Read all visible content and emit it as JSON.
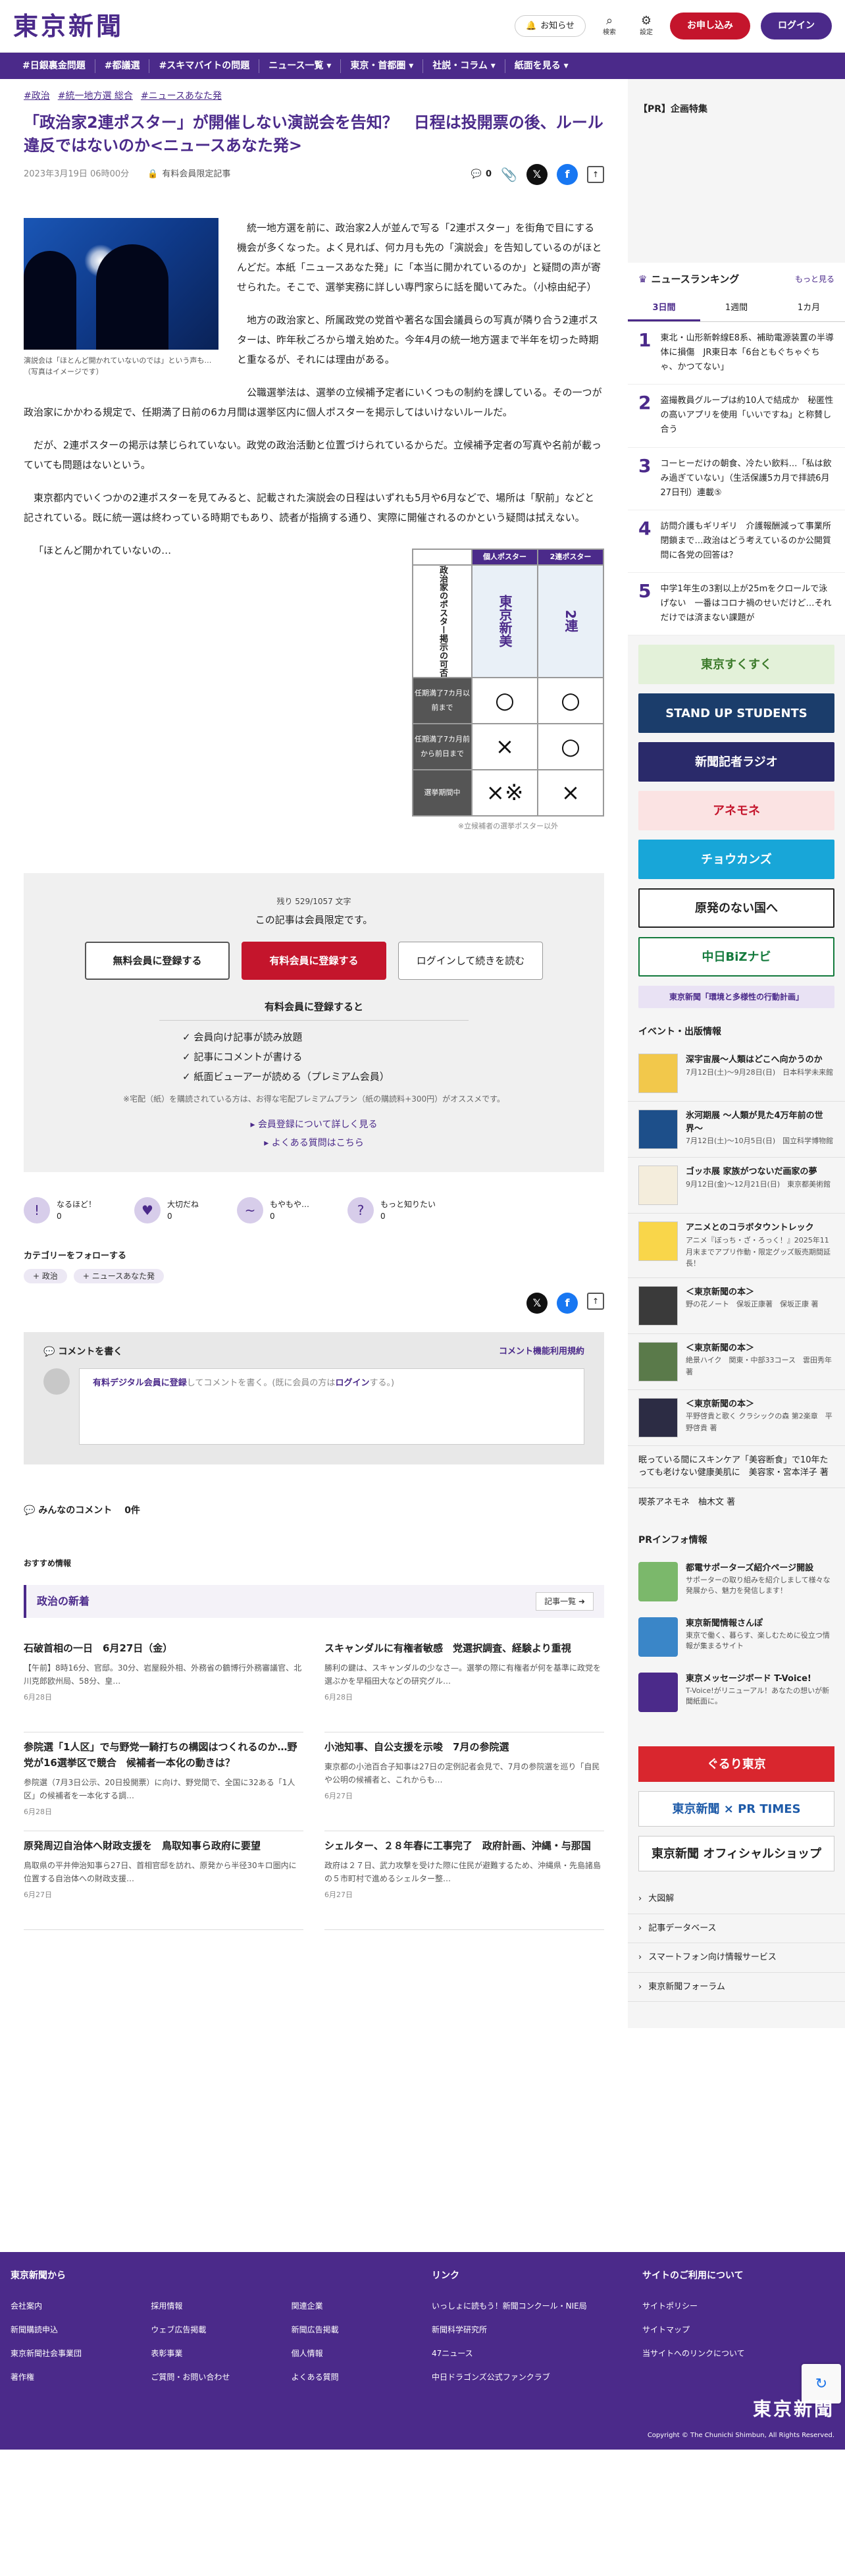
{
  "header": {
    "logo": "東京新聞",
    "notice_label": "お知らせ",
    "search_label": "検索",
    "settings_label": "設定",
    "apply_label": "お申し込み",
    "login_label": "ログイン"
  },
  "nav": [
    "#日銀裏金問題",
    "#都議選",
    "#スキマバイトの問題",
    "ニュース一覧 ▾",
    "東京・首都圏 ▾",
    "社説・コラム ▾",
    "紙面を見る ▾"
  ],
  "article": {
    "tags": [
      "#政治",
      "#統一地方選 総合",
      "#ニュースあなた発"
    ],
    "title": "「政治家2連ポスター」が開催しない演説会を告知？　日程は投開票の後、ルール違反ではないのか<ニュースあなた発>",
    "date": "2023年3月19日 06時00分",
    "members_only": "有料会員限定記事",
    "comment_count": "0",
    "photo_caption": "演説会は「ほとんど開かれていないのでは」という声も…（写真はイメージです）",
    "paragraphs": [
      "統一地方選を前に、政治家2人が並んで写る「2連ポスター」を街角で目にする機会が多くなった。よく見れば、何カ月も先の「演説会」を告知しているのがほとんどだ。本紙「ニュースあなた発」に「本当に開かれているのか」と疑問の声が寄せられた。そこで、選挙実務に詳しい専門家らに話を聞いてみた。（小椋由紀子）",
      "地方の政治家と、所属政党の党首や著名な国会議員らの写真が隣り合う2連ポスターは、昨年秋ごろから増え始めた。今年4月の統一地方選まで半年を切った時期と重なるが、それには理由がある。",
      "公職選挙法は、選挙の立候補予定者にいくつもの制約を課している。その一つが政治家にかかわる規定で、任期満了日前の6カ月間は選挙区内に個人ポスターを掲示してはいけないルールだ。",
      "だが、2連ポスターの掲示は禁じられていない。政党の政治活動と位置づけられているからだ。立候補予定者の写真や名前が載っていても問題はないという。",
      "東京都内でいくつかの2連ポスターを見てみると、記載された演説会の日程はいずれも5月や6月などで、場所は「駅前」などと記されている。既に統一選は終わっている時期でもあり、読者が指摘する通り、実際に開催されるのかという疑問は拭えない。",
      "「ほとんど開かれていないの…"
    ],
    "chart": {
      "col_headers": [
        "個人ポスター",
        "2連ポスター"
      ],
      "row_poster_label": "政治家のポスター掲示の可否",
      "rows": [
        {
          "label": "任期満了7カ月以前まで",
          "a": "○",
          "b": "○"
        },
        {
          "label": "任期満了7カ月前から前日まで",
          "a": "×",
          "b": "○"
        },
        {
          "label": "選挙期間中",
          "a": "×※",
          "b": "×"
        }
      ],
      "poster_text_a": "東京新美",
      "poster_text_b": "2連",
      "note": "※立候補者の選挙ポスター以外"
    }
  },
  "member": {
    "remain": "残り 529/1057 文字",
    "lead": "この記事は会員限定です。",
    "free_btn": "無料会員に登録する",
    "paid_btn": "有料会員に登録する",
    "login_btn": "ログインして続きを読む",
    "benefits_title": "有料会員に登録すると",
    "benefits": [
      "会員向け記事が読み放題",
      "記事にコメントが書ける",
      "紙面ビューアーが読める（プレミアム会員）"
    ],
    "note": "※宅配（紙）を購読されている方は、お得な宅配プレミアムプラン（紙の購読料+300円）がオススメです。",
    "link1": "会員登録について詳しく見る",
    "link2": "よくある質問はこちら"
  },
  "reactions": [
    {
      "icon": "!",
      "label": "なるほど！",
      "count": "0"
    },
    {
      "icon": "♥",
      "label": "大切だね",
      "count": "0"
    },
    {
      "icon": "~",
      "label": "もやもや…",
      "count": "0"
    },
    {
      "icon": "?",
      "label": "もっと知りたい",
      "count": "0"
    }
  ],
  "follow": {
    "title": "カテゴリーをフォローする",
    "tags": [
      "+ 政治",
      "+ ニュースあなた発"
    ]
  },
  "comment": {
    "title": "コメントを書く",
    "rules": "コメント機能利用規約",
    "prompt_link": "有料デジタル会員に登録",
    "prompt_mid": "してコメントを書く。(既に会員の方は",
    "prompt_login": "ログイン",
    "prompt_end": "する。)",
    "all_label": "みんなのコメント",
    "all_count": "0件"
  },
  "recommend_label": "おすすめ情報",
  "latest": {
    "title": "政治の新着",
    "more": "記事一覧 ➜",
    "items": [
      {
        "t": "石破首相の一日　6月27日（金）",
        "d": "【午前】8時16分、官邸。30分、岩屋殺外相、外務省の鶴博行外務審議官、北川克郎欧州局、58分、皇…",
        "dt": "6月28日"
      },
      {
        "t": "スキャンダルに有権者敏感　党選択調査、経験より重視",
        "d": "勝利の鍵は、スキャンダルの少なさ—。選挙の際に有権者が何を基準に政党を選ぶかを早稲田大などの研究グル…",
        "dt": "6月28日"
      },
      {
        "t": "参院選「1人区」で与野党一騎打ちの構図はつくれるのか…野党が16選挙区で競合　候補者一本化の動きは？",
        "d": "参院選（7月3日公示、20日投開票）に向け、野党間で、全国に32ある「1人区」の候補者を一本化する調…",
        "dt": "6月28日"
      },
      {
        "t": "小池知事、自公支援を示唆　7月の参院選",
        "d": "東京都の小池百合子知事は27日の定例記者会見で、7月の参院選を巡り「自民や公明の候補者と、これからも…",
        "dt": "6月27日"
      },
      {
        "t": "原発周辺自治体へ財政支援を　鳥取知事ら政府に要望",
        "d": "鳥取県の平井伸治知事ら27日、首相官邸を訪れ、原発から半径30キロ圏内に位置する自治体への財政支援…",
        "dt": "6月27日"
      },
      {
        "t": "シェルター、２８年春に工事完了　政府計画、沖縄・与那国",
        "d": "政府は２７日、武力攻撃を受けた際に住民が避難するため、沖縄県・先島諸島の５市町村で進めるシェルター整…",
        "dt": "6月27日"
      }
    ]
  },
  "sidebar": {
    "pr_title": "【PR】企画特集",
    "ranking_title": "ニュースランキング",
    "ranking_more": "もっと見る",
    "tabs": [
      "3日間",
      "1週間",
      "1カ月"
    ],
    "ranking": [
      "東北・山形新幹線E8系、補助電源装置の半導体に損傷　JR東日本「6台ともぐちゃぐちゃ、かつてない」",
      "盗撮教員グループは約10人で結成か　秘匿性の高いアプリを使用「いいですね」と称賛し合う",
      "コーヒーだけの朝食、冷たい飲料…「私は飲み過ぎていない」（生活保護5カ月で拝読6月27日刊）連載⑤",
      "訪問介護もギリギリ　介護報酬減って事業所閉鎖まで…政治はどう考えているのか公開質問に各党の回答は？",
      "中学1年生の3割以上が25mをクロールで泳げない　一番はコロナ禍のせいだけど…それだけでは済まない課題が"
    ],
    "banners": [
      "東京すくすく",
      "STAND UP STUDENTS",
      "新聞記者ラジオ",
      "アネモネ",
      "チョウカンズ",
      "原発のない国へ",
      "中日BiZナビ",
      "東京新聞「環境と多様性の行動計画」"
    ],
    "events_title": "イベント・出版情報",
    "events": [
      {
        "t": "深宇宙展〜人類はどこへ向かうのか",
        "d": "7月12日(土)〜9月28日(日)　日本科学未来館"
      },
      {
        "t": "氷河期展 〜人類が見た4万年前の世界〜",
        "d": "7月12日(土)〜10月5日(日)　国立科学博物館"
      },
      {
        "t": "ゴッホ展 家族がつないだ画家の夢",
        "d": "9月12日(金)〜12月21日(日)　東京都美術館"
      },
      {
        "t": "アニメとのコラボタウントレック",
        "d": "アニメ『ぼっち・ざ・ろっく！』2025年11月末までアプリ作動・限定グッズ販売期間延長！"
      },
      {
        "t": "＜東京新聞の本＞",
        "d": "野の花ノート　保坂正康著　保坂正康 著"
      },
      {
        "t": "＜東京新聞の本＞",
        "d": "絶景ハイク　関東・中部33コース　雲田秀年 著"
      },
      {
        "t": "＜東京新聞の本＞",
        "d": "平野啓貴と歌く クラシックの森 第2楽章　平野啓貴 著"
      }
    ],
    "book_extra": "眠っている間にスキンケア「美容断食」で10年たっても老けない健康美肌に　美容家・宮本洋子 著",
    "book_extra2": "喫茶アネモネ　柚木文 著",
    "pr_info_title": "PRインフォ情報",
    "pr_info": [
      {
        "t": "都電サポーターズ紹介ページ開設",
        "d": "サポーターの取り組みを紹介しまして様々な発展から、魅力を発信します！"
      },
      {
        "t": "東京新聞情報さんぽ",
        "d": "東京で働く、暮らす、楽しむために役立つ情報が集まるサイト"
      },
      {
        "t": "東京メッセージボード T-Voice!",
        "d": "T-Voice!がリニューアル！あなたの想いが新聞紙面に。"
      }
    ],
    "sbanners": [
      "ぐるり東京",
      "東京新聞 × PR TIMES",
      "東京新聞 オフィシャルショップ"
    ],
    "links": [
      "大図解",
      "記事データベース",
      "スマートフォン向け情報サービス",
      "東京新聞フォーラム"
    ]
  },
  "footer": {
    "col1_title": "東京新聞から",
    "col1": [
      "会社案内",
      "採用情報",
      "関連企業",
      "新聞購読申込",
      "ウェブ広告掲載",
      "新聞広告掲載",
      "東京新聞社会事業団",
      "表彰事業",
      "個人情報",
      "著作権",
      "ご質問・お問い合わせ",
      "よくある質問"
    ],
    "col2_title": "リンク",
    "col2": [
      "いっしょに読もう！新聞コンクール・NIE局",
      "新聞科学研究所",
      "47ニュース",
      "中日ドラゴンズ公式ファンクラブ"
    ],
    "col3_title": "サイトのご利用について",
    "col3": [
      "サイトポリシー",
      "サイトマップ",
      "当サイトへのリンクについて"
    ],
    "logo": "東京新聞",
    "copyright": "Copyright © The Chunichi Shimbun, All Rights Reserved."
  }
}
